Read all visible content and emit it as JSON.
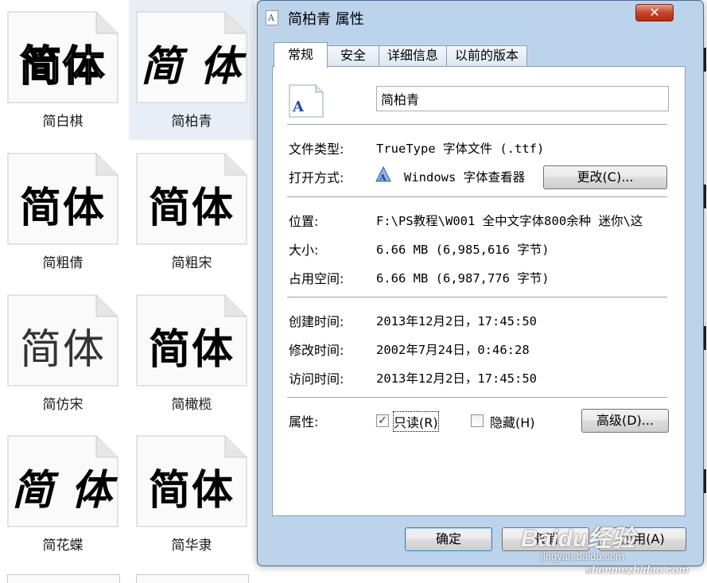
{
  "files": [
    {
      "name": "简白棋",
      "preview": "简体",
      "style": "outline"
    },
    {
      "name": "简柏青",
      "preview": "简 体",
      "style": "brush",
      "selected": true
    },
    {
      "name": "简粗倩",
      "preview": "简体",
      "style": "bold"
    },
    {
      "name": "简粗宋",
      "preview": "简体",
      "style": "bold"
    },
    {
      "name": "简仿宋",
      "preview": "简体",
      "style": "light"
    },
    {
      "name": "简橄榄",
      "preview": "简体",
      "style": "bold"
    },
    {
      "name": "简花蝶",
      "preview": "简 体",
      "style": "brush"
    },
    {
      "name": "简华隶",
      "preview": "简体",
      "style": "bold"
    }
  ],
  "dialog": {
    "title": "简柏青 属性",
    "close_glyph": "✕",
    "tabs": [
      "常规",
      "安全",
      "详细信息",
      "以前的版本"
    ],
    "active_tab": "常规",
    "file_name": "简柏青",
    "file_icon_letter": "A",
    "type_label": "文件类型:",
    "type_value": "TrueType 字体文件 (.ttf)",
    "opens_label": "打开方式:",
    "opens_value": "Windows 字体查看器",
    "change_button": "更改(C)...",
    "location_label": "位置:",
    "location_value": "F:\\PS教程\\W001  全中文字体800余种  迷你\\这",
    "size_label": "大小:",
    "size_value": "6.66 MB (6,985,616 字节)",
    "disk_label": "占用空间:",
    "disk_value": "6.66 MB (6,987,776 字节)",
    "created_label": "创建时间:",
    "created_value": "2013年12月2日，17:45:50",
    "modified_label": "修改时间:",
    "modified_value": "2002年7月24日，0:46:28",
    "accessed_label": "访问时间:",
    "accessed_value": "2013年12月2日，17:45:50",
    "attr_label": "属性:",
    "readonly_label": "只读(R)",
    "readonly_checked": true,
    "hidden_label": "隐藏(H)",
    "hidden_checked": false,
    "advanced_button": "高级(D)...",
    "ok_button": "确定",
    "cancel_button": "取消",
    "apply_button": "应用(A)"
  },
  "watermark": {
    "logo": "Baidu经验",
    "url1": "jingyan.baidu.com",
    "url2": "shenmezhidao.com"
  }
}
